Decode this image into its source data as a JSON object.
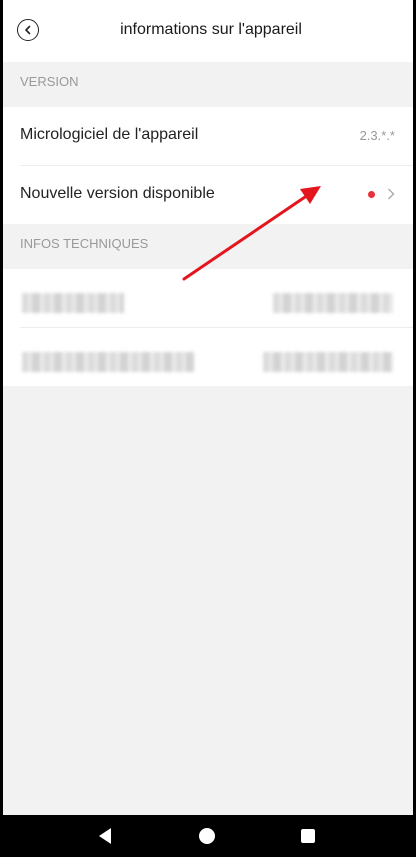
{
  "header": {
    "title": "informations sur l'appareil"
  },
  "version_section": {
    "heading": "VERSION",
    "firmware": {
      "label": "Micrologiciel de l'appareil",
      "value": "2.3.*.*"
    },
    "new_version": {
      "label": "Nouvelle version disponible"
    }
  },
  "tech_section": {
    "heading": "INFOS TECHNIQUES"
  },
  "colors": {
    "accent_dot": "#e8313a",
    "annotation_arrow": "#e3161e"
  },
  "icons": {
    "back": "back-circle-icon",
    "chevron": "chevron-right-icon",
    "nav_back": "nav-back-triangle-icon",
    "nav_home": "nav-home-circle-icon",
    "nav_recent": "nav-recent-square-icon"
  }
}
